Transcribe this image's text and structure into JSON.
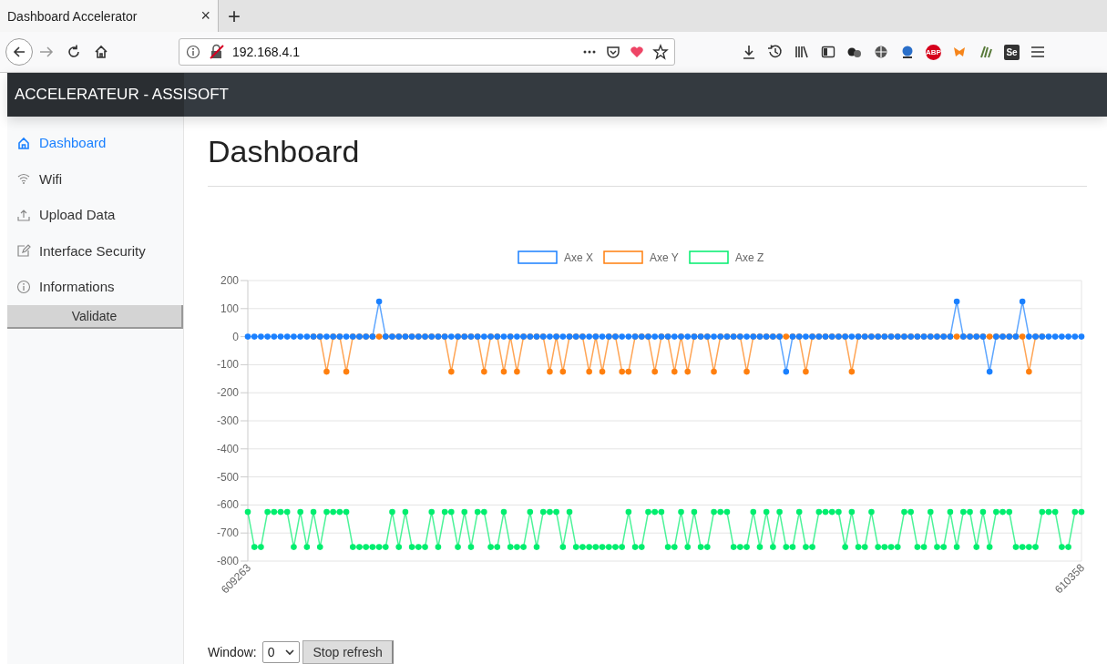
{
  "browser": {
    "tab": {
      "title": "Dashboard Accelerator",
      "close": "×"
    },
    "new_tab": "+",
    "url": "192.168.4.1",
    "toolbar_badges": [
      "ABP",
      "Se"
    ]
  },
  "header": {
    "title": "ACCELERATEUR - ASSISOFT"
  },
  "sidebar": {
    "items": [
      {
        "label": "Dashboard",
        "kind": "home",
        "selected": true
      },
      {
        "label": "Wifi",
        "kind": "wifi",
        "selected": false
      },
      {
        "label": "Upload Data",
        "kind": "upload",
        "selected": false
      },
      {
        "label": "Interface Security",
        "kind": "edit",
        "selected": false
      },
      {
        "label": "Informations",
        "kind": "info",
        "selected": false
      }
    ],
    "validate_button": "Validate"
  },
  "main": {
    "title": "Dashboard",
    "chart_data": {
      "type": "line",
      "ylim": [
        -800,
        200
      ],
      "grid": true,
      "legend": true,
      "categories": [
        "609263",
        null,
        null,
        null,
        null,
        null,
        null,
        null,
        null,
        null,
        null,
        null,
        null,
        null,
        null,
        null,
        null,
        null,
        null,
        null,
        null,
        null,
        null,
        null,
        null,
        null,
        null,
        null,
        null,
        null,
        null,
        null,
        null,
        null,
        null,
        null,
        null,
        null,
        null,
        null,
        null,
        null,
        null,
        null,
        null,
        null,
        null,
        null,
        null,
        null,
        null,
        null,
        null,
        null,
        null,
        null,
        null,
        null,
        null,
        null,
        null,
        null,
        null,
        null,
        null,
        null,
        null,
        null,
        null,
        null,
        null,
        null,
        null,
        null,
        null,
        null,
        null,
        null,
        null,
        null,
        null,
        null,
        null,
        null,
        null,
        null,
        null,
        null,
        null,
        null,
        null,
        null,
        null,
        null,
        null,
        null,
        null,
        null,
        null,
        null,
        null,
        null,
        null,
        null,
        null,
        null,
        null,
        null,
        null,
        null,
        null,
        null,
        null,
        null,
        null,
        null,
        null,
        null,
        null,
        null,
        null,
        null,
        null,
        null,
        null,
        null,
        null,
        "610358"
      ],
      "yticks": [
        200,
        100,
        0,
        -100,
        -200,
        -300,
        -400,
        -500,
        -600,
        -700,
        -800
      ],
      "series": [
        {
          "name": "Axe X",
          "color": "#1a80ff",
          "marker": "circle",
          "values": [
            0,
            0,
            0,
            0,
            0,
            0,
            0,
            0,
            0,
            0,
            0,
            0,
            0,
            0,
            0,
            0,
            0,
            0,
            0,
            0,
            125,
            0,
            0,
            0,
            0,
            0,
            0,
            0,
            0,
            0,
            0,
            0,
            0,
            0,
            0,
            0,
            0,
            0,
            0,
            0,
            0,
            0,
            0,
            0,
            0,
            0,
            0,
            0,
            0,
            0,
            0,
            0,
            0,
            0,
            0,
            0,
            0,
            0,
            0,
            0,
            0,
            0,
            0,
            0,
            0,
            0,
            0,
            0,
            0,
            0,
            0,
            0,
            0,
            0,
            0,
            0,
            0,
            0,
            0,
            0,
            0,
            0,
            -125,
            0,
            0,
            0,
            0,
            0,
            0,
            0,
            0,
            0,
            0,
            0,
            0,
            0,
            0,
            0,
            0,
            0,
            0,
            0,
            0,
            0,
            0,
            0,
            0,
            0,
            125,
            0,
            0,
            0,
            0,
            -125,
            0,
            0,
            0,
            0,
            125,
            0,
            0,
            0,
            0,
            0,
            0,
            0,
            0,
            0
          ]
        },
        {
          "name": "Axe Y",
          "color": "#ff7f0e",
          "marker": "circle",
          "values": [
            null,
            null,
            null,
            null,
            null,
            null,
            null,
            null,
            null,
            null,
            0,
            0,
            -125,
            0,
            0,
            -125,
            0,
            0,
            0,
            0,
            0,
            0,
            0,
            0,
            0,
            0,
            0,
            0,
            0,
            0,
            0,
            -125,
            0,
            0,
            0,
            0,
            -125,
            0,
            0,
            -125,
            0,
            -125,
            0,
            0,
            0,
            0,
            -125,
            0,
            -125,
            0,
            0,
            0,
            -125,
            0,
            -125,
            0,
            0,
            -125,
            -125,
            0,
            0,
            0,
            -125,
            0,
            0,
            -125,
            0,
            -125,
            0,
            0,
            0,
            -125,
            0,
            0,
            0,
            0,
            -125,
            0,
            0,
            0,
            0,
            0,
            0,
            0,
            0,
            -125,
            0,
            0,
            0,
            0,
            0,
            0,
            -125,
            0,
            0,
            0,
            0,
            0,
            0,
            0,
            0,
            0,
            0,
            0,
            0,
            0,
            0,
            0,
            0,
            0,
            0,
            0,
            0,
            0,
            0,
            0,
            0,
            0,
            0,
            -125,
            0,
            0,
            null,
            null,
            null,
            null,
            null,
            null
          ]
        },
        {
          "name": "Axe Z",
          "color": "#00ee6e",
          "marker": "circle",
          "values": [
            -625,
            -750,
            -750,
            -625,
            -625,
            -625,
            -625,
            -750,
            -625,
            -750,
            -625,
            -750,
            -625,
            -625,
            -625,
            -625,
            -750,
            -750,
            -750,
            -750,
            -750,
            -750,
            -625,
            -750,
            -625,
            -750,
            -750,
            -750,
            -625,
            -750,
            -625,
            -625,
            -750,
            -625,
            -750,
            -625,
            -625,
            -750,
            -750,
            -625,
            -750,
            -750,
            -750,
            -625,
            -750,
            -625,
            -625,
            -625,
            -750,
            -625,
            -750,
            -750,
            -750,
            -750,
            -750,
            -750,
            -750,
            -750,
            -625,
            -750,
            -750,
            -625,
            -625,
            -625,
            -750,
            -750,
            -625,
            -750,
            -625,
            -750,
            -750,
            -625,
            -625,
            -625,
            -750,
            -750,
            -750,
            -625,
            -750,
            -625,
            -750,
            -625,
            -750,
            -750,
            -625,
            -750,
            -750,
            -625,
            -625,
            -625,
            -625,
            -750,
            -625,
            -750,
            -750,
            -625,
            -750,
            -750,
            -750,
            -750,
            -625,
            -625,
            -750,
            -750,
            -625,
            -750,
            -750,
            -625,
            -750,
            -625,
            -625,
            -750,
            -625,
            -750,
            -625,
            -625,
            -625,
            -750,
            -750,
            -750,
            -750,
            -625,
            -625,
            -625,
            -750,
            -750,
            -625,
            -625
          ]
        }
      ]
    },
    "controls": {
      "window_label": "Window:",
      "window_value": "0",
      "stop_button": "Stop refresh"
    }
  }
}
